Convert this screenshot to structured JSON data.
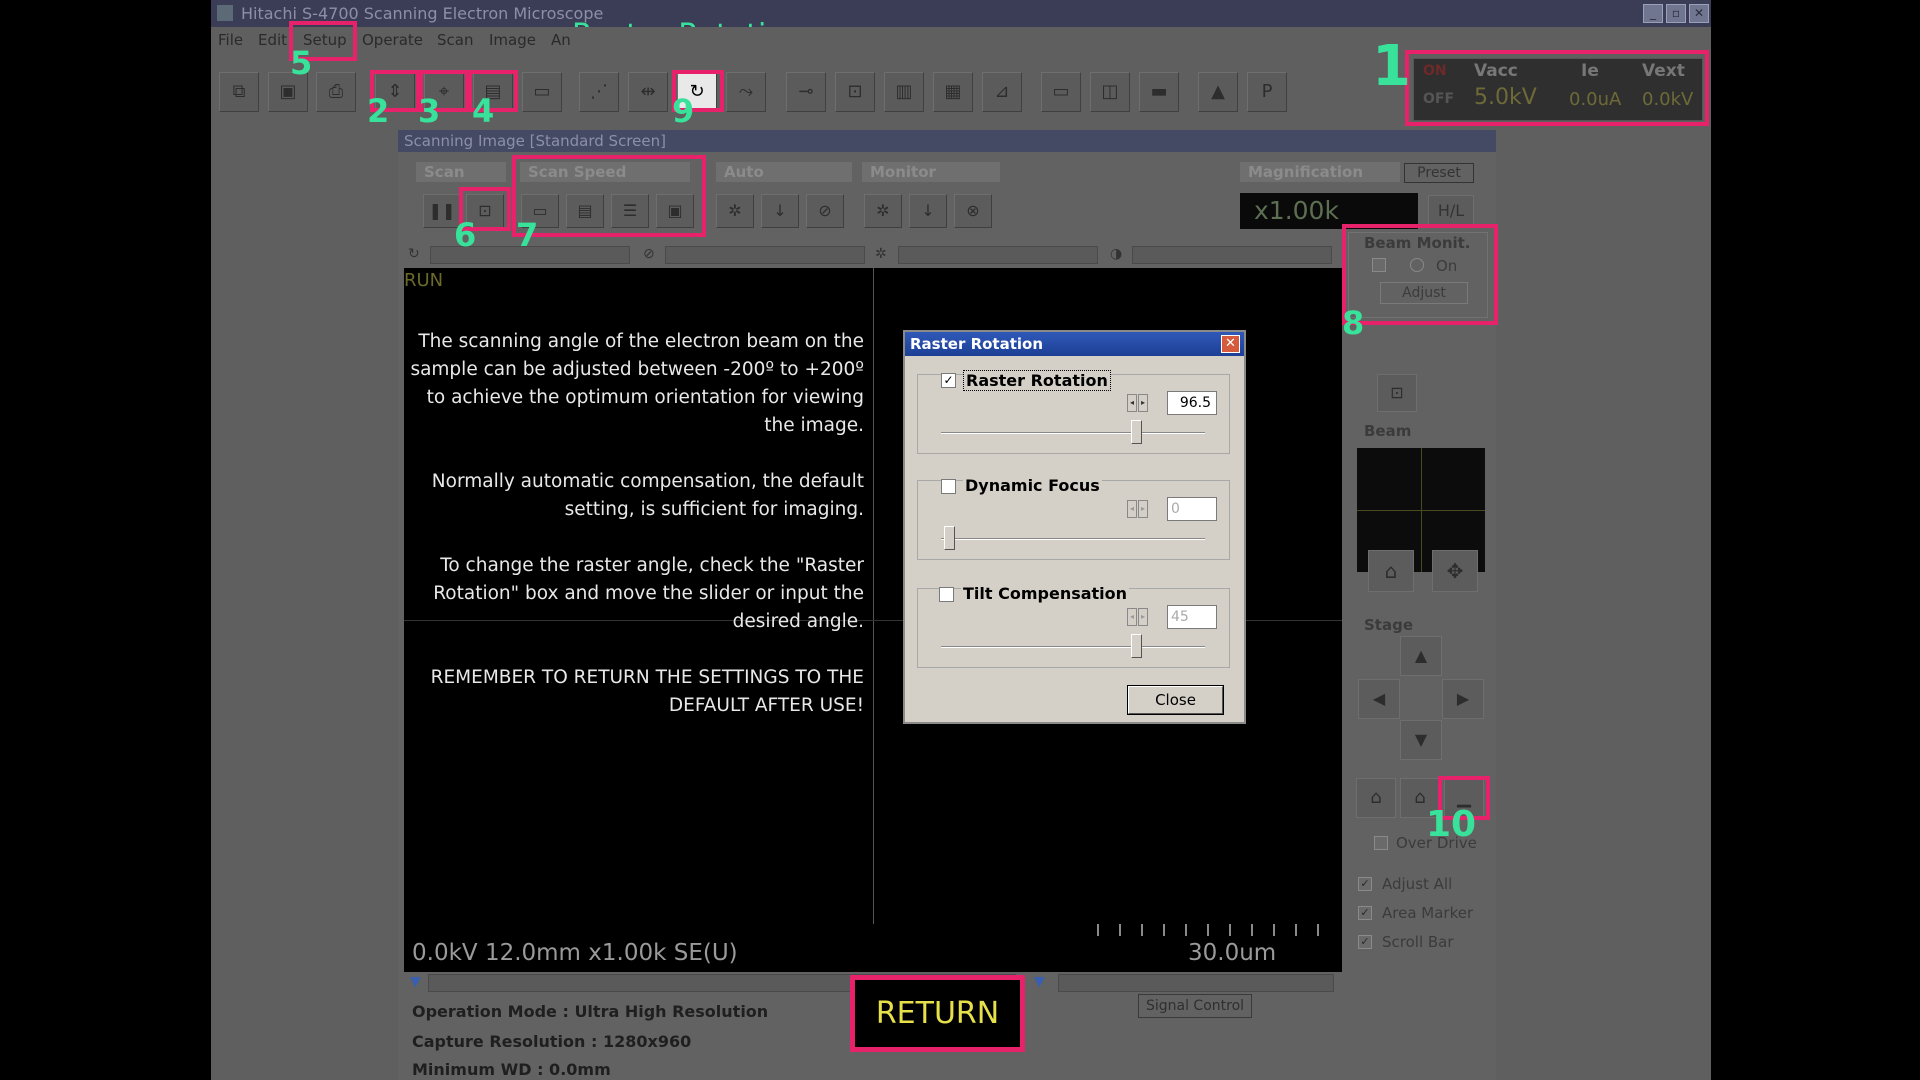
{
  "app": {
    "title": "Hitachi S-4700 Scanning Electron Microscope",
    "overlay_title": "Raster Rotation",
    "menu": [
      "File",
      "Edit",
      "Setup",
      "Operate",
      "Scan",
      "Image",
      "An"
    ]
  },
  "status": {
    "on": "ON",
    "off": "OFF",
    "vacc_label": "Vacc",
    "vacc_value": "5.0kV",
    "ie_label": "Ie",
    "ie_value": "0.0uA",
    "vext_label": "Vext",
    "vext_value": "0.0kV"
  },
  "scan_window": {
    "title": "Scanning Image [Standard Screen]",
    "groups": {
      "scan": "Scan",
      "scan_speed": "Scan Speed",
      "auto": "Auto",
      "monitor": "Monitor",
      "magnification": "Magnification"
    },
    "preset": "Preset",
    "magnification_value": "x1.00k",
    "hl": "H/L",
    "run": "RUN",
    "description": [
      "The scanning angle of the electron beam on the sample can be adjusted between -200º to +200º to achieve the optimum orientation for viewing the image.",
      "Normally automatic compensation, the default setting, is sufficient for imaging.",
      "To change the raster angle, check the \"Raster Rotation\" box and move the slider or input the desired angle.",
      "REMEMBER TO RETURN THE SETTINGS TO THE DEFAULT AFTER USE!"
    ],
    "image_info": "0.0kV 12.0mm x1.00k SE(U)",
    "scale_label": "30.0um",
    "operation_mode": "Operation Mode : Ultra High Resolution",
    "capture_resolution": "Capture Resolution : 1280x960",
    "minimum_wd": "Minimum WD : 0.0mm",
    "signal_control": "Signal Control"
  },
  "right_panel": {
    "beam_monit": "Beam Monit.",
    "on": "On",
    "adjust": "Adjust",
    "beam": "Beam",
    "stage": "Stage",
    "over_drive": "Over Drive",
    "adjust_all": "Adjust All",
    "area_marker": "Area Marker",
    "scroll_bar": "Scroll Bar"
  },
  "dialog": {
    "title": "Raster Rotation",
    "raster_rotation": {
      "label": "Raster Rotation",
      "checked": true,
      "value": "96.5",
      "slider_fraction": 0.74
    },
    "dynamic_focus": {
      "label": "Dynamic Focus",
      "checked": false,
      "value": "0",
      "slider_fraction": 0.03
    },
    "tilt_compensation": {
      "label": "Tilt Compensation",
      "checked": false,
      "value": "45",
      "slider_fraction": 0.74
    },
    "close": "Close"
  },
  "annotations": [
    "1",
    "2",
    "3",
    "4",
    "5",
    "6",
    "7",
    "8",
    "9",
    "10"
  ],
  "return_label": "RETURN",
  "colors": {
    "highlight": "#e8216b",
    "annotation": "#39e29a",
    "return_text": "#e6e14a",
    "dialog_title": "#2f59b8"
  }
}
